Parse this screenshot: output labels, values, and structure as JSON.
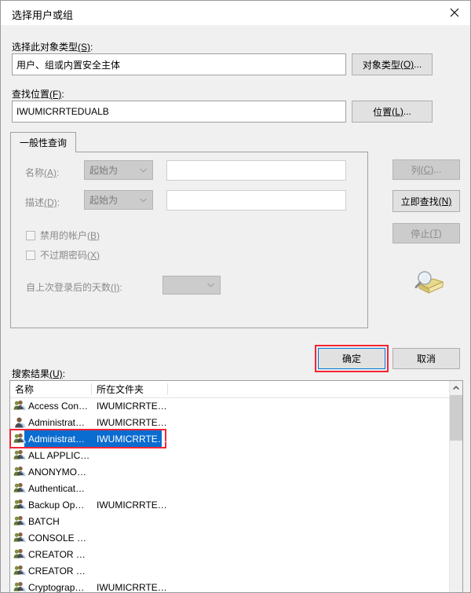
{
  "window": {
    "title": "选择用户或组",
    "close_icon": "close-icon"
  },
  "object_type": {
    "label_text": "选择此对象类型",
    "label_accel": "(S)",
    "label_suffix": ":",
    "value": "用户、组或内置安全主体",
    "button_text": "对象类型",
    "button_accel": "(O)",
    "button_suffix": "..."
  },
  "location": {
    "label_text": "查找位置",
    "label_accel": "(F)",
    "label_suffix": ":",
    "value": "IWUMICRRTEDUALB",
    "button_text": "位置",
    "button_accel": "(L)",
    "button_suffix": "..."
  },
  "tabs": [
    {
      "label": "一般性查询",
      "selected": true
    }
  ],
  "query": {
    "name": {
      "label_text": "名称",
      "label_accel": "(A)",
      "label_suffix": ":",
      "operator": "起始为",
      "value": "",
      "caret_icon": "chevron-down-icon"
    },
    "description": {
      "label_text": "描述",
      "label_accel": "(D)",
      "label_suffix": ":",
      "operator": "起始为",
      "value": "",
      "caret_icon": "chevron-down-icon"
    },
    "checkboxes": [
      {
        "text": "禁用的帐户",
        "accel": "(B)",
        "checked": false
      },
      {
        "text": "不过期密码",
        "accel": "(X)",
        "checked": false
      }
    ],
    "days_since_logon": {
      "label_text": "自上次登录后的天数",
      "label_accel": "(I)",
      "label_suffix": ":",
      "value": "",
      "caret_icon": "chevron-down-icon"
    }
  },
  "side_buttons": [
    {
      "text": "列",
      "accel": "(C)",
      "suffix": "...",
      "enabled": false,
      "name": "columns-button"
    },
    {
      "text": "立即查找",
      "accel": "(N)",
      "suffix": "",
      "enabled": true,
      "name": "find-now-button"
    },
    {
      "text": "停止",
      "accel": "(T)",
      "suffix": "",
      "enabled": false,
      "name": "stop-button"
    }
  ],
  "magnifier_icon": "magnifier-folder-icon",
  "footer": {
    "ok": "确定",
    "cancel": "取消"
  },
  "results": {
    "label_text": "搜索结果",
    "label_accel": "(U)",
    "label_suffix": ":",
    "columns": [
      "名称",
      "所在文件夹"
    ],
    "rows": [
      {
        "icon": "group-icon",
        "name": "Access Con…",
        "folder": "IWUMICRRTE…",
        "selected": false
      },
      {
        "icon": "user-icon",
        "name": "Administrat…",
        "folder": "IWUMICRRTE…",
        "selected": false
      },
      {
        "icon": "group-icon",
        "name": "Administrat…",
        "folder": "IWUMICRRTE…",
        "selected": true
      },
      {
        "icon": "group-icon",
        "name": "ALL APPLIC…",
        "folder": "",
        "selected": false
      },
      {
        "icon": "group-icon",
        "name": "ANONYMO…",
        "folder": "",
        "selected": false
      },
      {
        "icon": "group-icon",
        "name": "Authenticat…",
        "folder": "",
        "selected": false
      },
      {
        "icon": "group-icon",
        "name": "Backup Op…",
        "folder": "IWUMICRRTE…",
        "selected": false
      },
      {
        "icon": "group-icon",
        "name": "BATCH",
        "folder": "",
        "selected": false
      },
      {
        "icon": "group-icon",
        "name": "CONSOLE …",
        "folder": "",
        "selected": false
      },
      {
        "icon": "group-icon",
        "name": "CREATOR …",
        "folder": "",
        "selected": false
      },
      {
        "icon": "group-icon",
        "name": "CREATOR …",
        "folder": "",
        "selected": false
      },
      {
        "icon": "group-icon",
        "name": "Cryptograp…",
        "folder": "IWUMICRRTE…",
        "selected": false
      }
    ],
    "scrollbar": {
      "up_arrow_icon": "chevron-up-icon"
    }
  },
  "colors": {
    "dialog_bg": "#f0f0f0",
    "titlebar_bg": "#ffffff",
    "selection_blue": "#0a6cd0",
    "annotation_red": "#f42534",
    "focus_blue": "#0078d7"
  }
}
